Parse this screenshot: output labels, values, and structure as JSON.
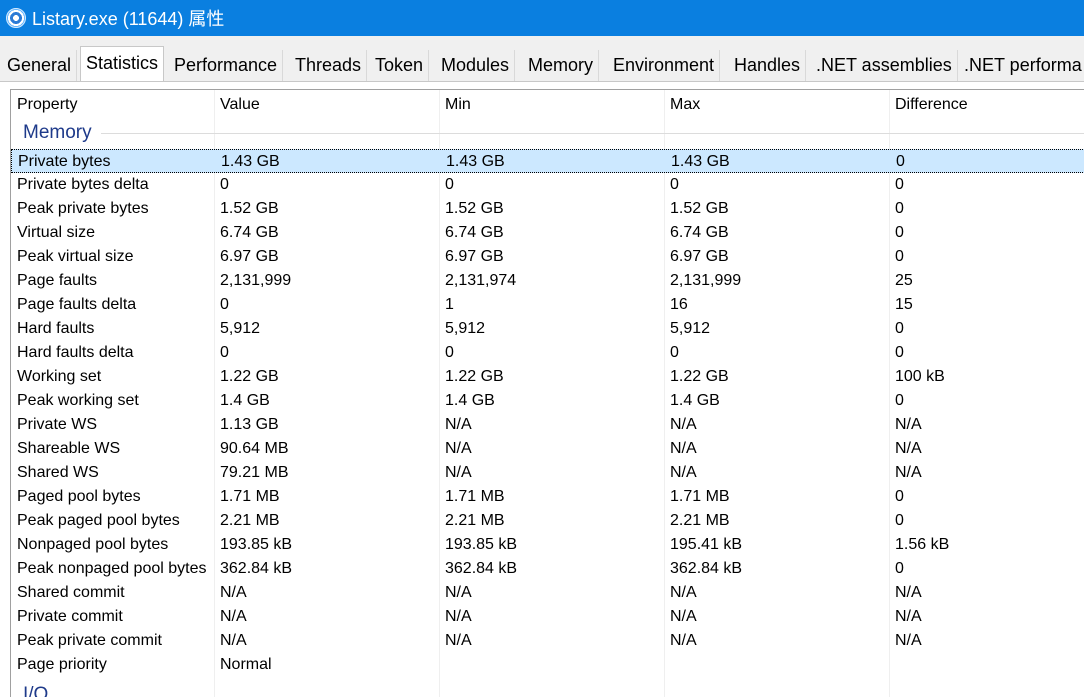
{
  "window": {
    "title": "Listary.exe (11644) 属性"
  },
  "tabs": [
    {
      "label": "General",
      "active": false
    },
    {
      "label": "Statistics",
      "active": true
    },
    {
      "label": "Performance",
      "active": false
    },
    {
      "label": "Threads",
      "active": false
    },
    {
      "label": "Token",
      "active": false
    },
    {
      "label": "Modules",
      "active": false
    },
    {
      "label": "Memory",
      "active": false
    },
    {
      "label": "Environment",
      "active": false
    },
    {
      "label": "Handles",
      "active": false
    },
    {
      "label": ".NET assemblies",
      "active": false
    },
    {
      "label": ".NET performa",
      "active": false
    }
  ],
  "columns": [
    "Property",
    "Value",
    "Min",
    "Max",
    "Difference"
  ],
  "groups": [
    {
      "name": "Memory",
      "rows": [
        [
          "Private bytes",
          "1.43 GB",
          "1.43 GB",
          "1.43 GB",
          "0"
        ],
        [
          "Private bytes delta",
          "0",
          "0",
          "0",
          "0"
        ],
        [
          "Peak private bytes",
          "1.52 GB",
          "1.52 GB",
          "1.52 GB",
          "0"
        ],
        [
          "Virtual size",
          "6.74 GB",
          "6.74 GB",
          "6.74 GB",
          "0"
        ],
        [
          "Peak virtual size",
          "6.97 GB",
          "6.97 GB",
          "6.97 GB",
          "0"
        ],
        [
          "Page faults",
          "2,131,999",
          "2,131,974",
          "2,131,999",
          "25"
        ],
        [
          "Page faults delta",
          "0",
          "1",
          "16",
          "15"
        ],
        [
          "Hard faults",
          "5,912",
          "5,912",
          "5,912",
          "0"
        ],
        [
          "Hard faults delta",
          "0",
          "0",
          "0",
          "0"
        ],
        [
          "Working set",
          "1.22 GB",
          "1.22 GB",
          "1.22 GB",
          "100 kB"
        ],
        [
          "Peak working set",
          "1.4 GB",
          "1.4 GB",
          "1.4 GB",
          "0"
        ],
        [
          "Private WS",
          "1.13 GB",
          "N/A",
          "N/A",
          "N/A"
        ],
        [
          "Shareable WS",
          "90.64 MB",
          "N/A",
          "N/A",
          "N/A"
        ],
        [
          "Shared WS",
          "79.21 MB",
          "N/A",
          "N/A",
          "N/A"
        ],
        [
          "Paged pool bytes",
          "1.71 MB",
          "1.71 MB",
          "1.71 MB",
          "0"
        ],
        [
          "Peak paged pool bytes",
          "2.21 MB",
          "2.21 MB",
          "2.21 MB",
          "0"
        ],
        [
          "Nonpaged pool bytes",
          "193.85 kB",
          "193.85 kB",
          "195.41 kB",
          "1.56 kB"
        ],
        [
          "Peak nonpaged pool bytes",
          "362.84 kB",
          "362.84 kB",
          "362.84 kB",
          "0"
        ],
        [
          "Shared commit",
          "N/A",
          "N/A",
          "N/A",
          "N/A"
        ],
        [
          "Private commit",
          "N/A",
          "N/A",
          "N/A",
          "N/A"
        ],
        [
          "Peak private commit",
          "N/A",
          "N/A",
          "N/A",
          "N/A"
        ],
        [
          "Page priority",
          "Normal",
          "",
          "",
          ""
        ]
      ]
    },
    {
      "name": "I/O",
      "rows": []
    }
  ],
  "selected_row": "Private bytes"
}
